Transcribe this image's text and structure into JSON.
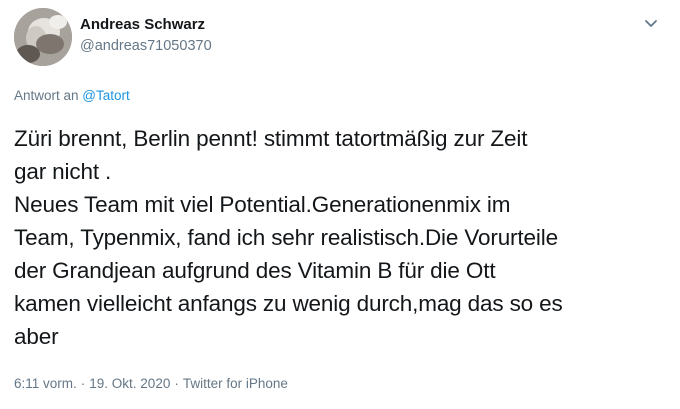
{
  "author": {
    "display_name": "Andreas Schwarz",
    "handle": "@andreas71050370"
  },
  "reply": {
    "prefix": "Antwort an ",
    "mention": "@Tatort"
  },
  "tweet": {
    "text": "Züri brennt, Berlin pennt! stimmt tatortmäßig zur Zeit\ngar nicht .\nNeues Team mit viel Potential.Generationenmix im\nTeam, Typenmix, fand ich sehr realistisch.Die Vorurteile\nder Grandjean aufgrund des Vitamin B für die Ott\nkamen vielleicht anfangs zu wenig durch,mag das so es\naber"
  },
  "meta": {
    "time": "6:11 vorm.",
    "separator": "·",
    "date": "19. Okt. 2020",
    "source": "Twitter for iPhone"
  },
  "icons": {
    "avatar": "avatar",
    "more": "chevron-down-icon"
  },
  "colors": {
    "text": "#14171a",
    "muted": "#657786",
    "link": "#1b95e0"
  }
}
